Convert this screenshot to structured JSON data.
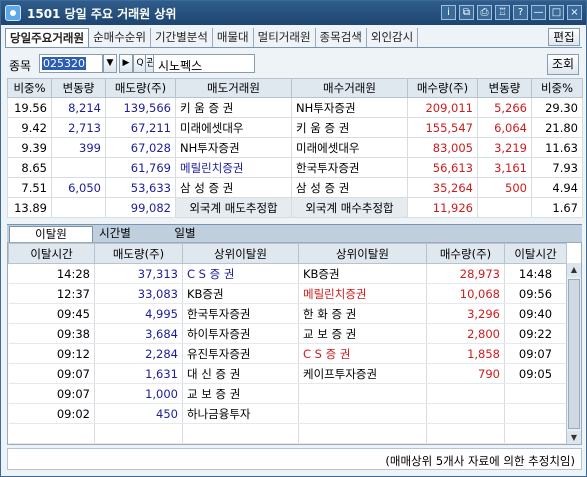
{
  "window": {
    "title": "1501 당일 주요 거래원 상위",
    "buttons": [
      "i",
      "⧉",
      "⎙",
      "♖",
      "?",
      "—",
      "□",
      "×"
    ]
  },
  "tabs": [
    "당일주요거래원",
    "순매수순위",
    "기간별분석",
    "매물대",
    "멀티거래원",
    "종목검색",
    "외인감시"
  ],
  "edit_label": "편집",
  "search": {
    "label": "종목",
    "code": "025320",
    "code_arrow": "▼",
    "next_arrow": "▶",
    "search_icon": "Q",
    "pen_label": "관",
    "name": "시노펙스",
    "query_label": "조회"
  },
  "top_table": {
    "headers": [
      "비중%",
      "변동량",
      "매도량(주)",
      "매도거래원",
      "매수거래원",
      "매수량(주)",
      "변동량",
      "비중%"
    ],
    "rows": [
      [
        "19.56",
        "8,214",
        "139,566",
        "키 움 증 권",
        "NH투자증권",
        "209,011",
        "5,266",
        "29.30"
      ],
      [
        "9.42",
        "2,713",
        "67,211",
        "미래에셋대우",
        "키 움 증 권",
        "155,547",
        "6,064",
        "21.80"
      ],
      [
        "9.39",
        "399",
        "67,028",
        "NH투자증권",
        "미래에셋대우",
        "83,005",
        "3,219",
        "11.63"
      ],
      [
        "8.65",
        "",
        "61,769",
        "메릴린치증권",
        "한국투자증권",
        "56,613",
        "3,161",
        "7.93"
      ],
      [
        "7.51",
        "6,050",
        "53,633",
        "삼 성 증 권",
        "삼 성 증 권",
        "35,264",
        "500",
        "4.94"
      ]
    ],
    "summary": [
      "13.89",
      "",
      "99,082",
      "외국계 매도추정합",
      "외국계 매수추정합",
      "11,926",
      "",
      "1.67"
    ]
  },
  "bottom_tabs": [
    "이탈원",
    "시간별",
    "일별"
  ],
  "bottom_table": {
    "headers": [
      "이탈시간",
      "매도량(주)",
      "상위이탈원",
      "상위이탈원",
      "매수량(주)",
      "이탈시간"
    ],
    "rows": [
      [
        "14:28",
        "37,313",
        "C S 증 권",
        "KB증권",
        "28,973",
        "14:48"
      ],
      [
        "12:37",
        "33,083",
        "KB증권",
        "메릴린치증권",
        "10,068",
        "09:56"
      ],
      [
        "09:45",
        "4,995",
        "한국투자증권",
        "한 화 증 권",
        "3,296",
        "09:40"
      ],
      [
        "09:38",
        "3,684",
        "하이투자증권",
        "교 보 증 권",
        "2,800",
        "09:22"
      ],
      [
        "09:12",
        "2,284",
        "유진투자증권",
        "C S 증 권",
        "1,858",
        "09:07"
      ],
      [
        "09:07",
        "1,631",
        "대 신 증 권",
        "케이프투자증권",
        "790",
        "09:05"
      ],
      [
        "09:07",
        "1,000",
        "교 보 증 권",
        "",
        "",
        ""
      ],
      [
        "09:02",
        "450",
        "하나금융투자",
        "",
        "",
        ""
      ],
      [
        "",
        "",
        "",
        "",
        "",
        ""
      ]
    ]
  },
  "footer": "(매매상위 5개사 자료에 의한 추정치임)",
  "colors": {
    "title_bar": "#2f5d8c",
    "sell": "#1c1c9c",
    "buy": "#cf1b1b"
  }
}
